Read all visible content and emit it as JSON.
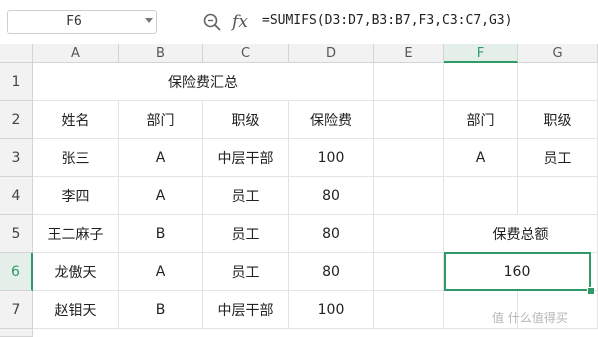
{
  "formula_bar": {
    "cell_ref": "F6",
    "fx_label": "fx",
    "formula": "=SUMIFS(D3:D7,B3:B7,F3,C3:C7,G3)"
  },
  "columns": [
    "A",
    "B",
    "C",
    "D",
    "E",
    "F",
    "G"
  ],
  "selected_column": "F",
  "rows": [
    "1",
    "2",
    "3",
    "4",
    "5",
    "6",
    "7"
  ],
  "selected_row": "6",
  "sheet": {
    "title": "保险费汇总",
    "headers": [
      "姓名",
      "部门",
      "职级",
      "保险费"
    ],
    "records": [
      [
        "张三",
        "A",
        "中层干部",
        "100"
      ],
      [
        "李四",
        "A",
        "员工",
        "80"
      ],
      [
        "王二麻子",
        "B",
        "员工",
        "80"
      ],
      [
        "龙傲天",
        "A",
        "员工",
        "80"
      ],
      [
        "赵钼天",
        "B",
        "中层干部",
        "100"
      ]
    ],
    "criteria_headers": [
      "部门",
      "职级"
    ],
    "criteria_values": [
      "A",
      "员工"
    ],
    "result_label": "保费总额",
    "result_value": "160"
  },
  "watermark": "值 什么值得买",
  "accent_color": "#2e9a68"
}
